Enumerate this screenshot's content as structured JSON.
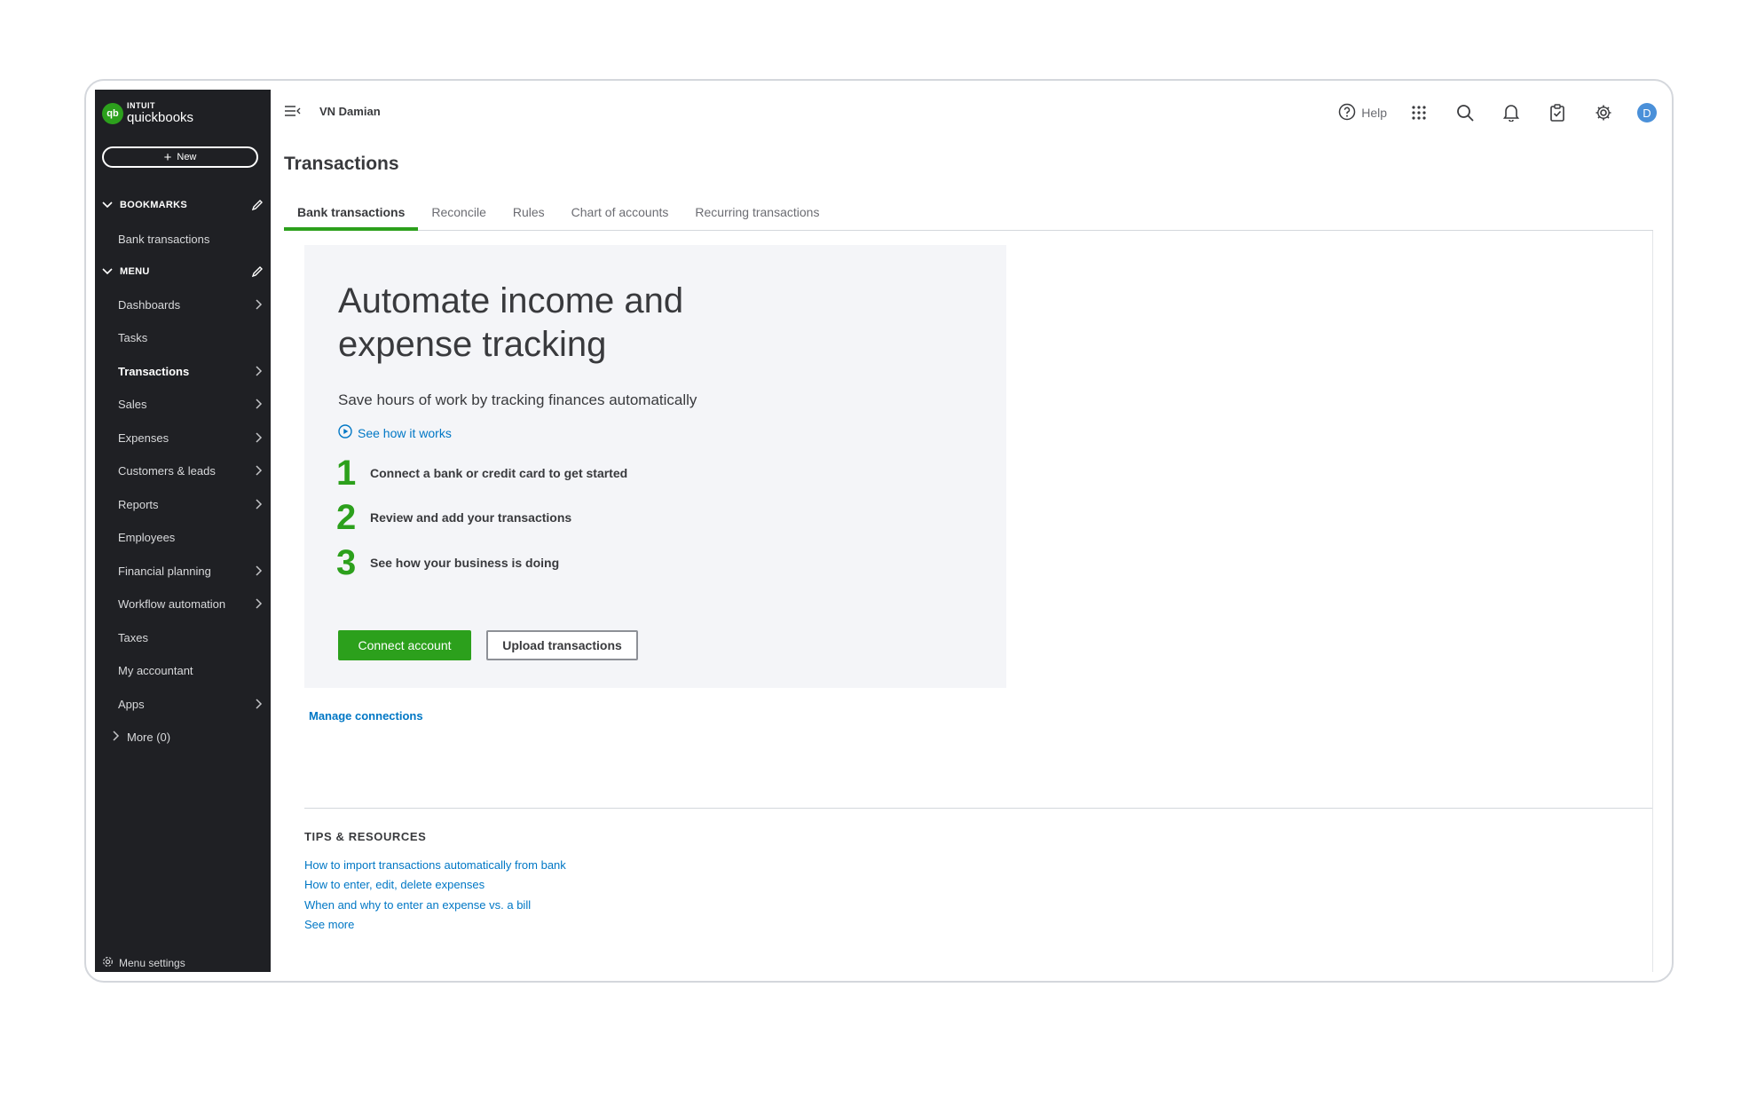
{
  "brand": {
    "intuit": "INTUIT",
    "product": "quickbooks",
    "badge": "qb"
  },
  "sidebar": {
    "new_label": "New",
    "bookmarks_title": "BOOKMARKS",
    "bookmarks": [
      {
        "label": "Bank transactions"
      }
    ],
    "menu_title": "MENU",
    "items": [
      {
        "label": "Dashboards",
        "arrow": true
      },
      {
        "label": "Tasks",
        "arrow": false
      },
      {
        "label": "Transactions",
        "arrow": true,
        "active": true
      },
      {
        "label": "Sales",
        "arrow": true
      },
      {
        "label": "Expenses",
        "arrow": true
      },
      {
        "label": "Customers & leads",
        "arrow": true
      },
      {
        "label": "Reports",
        "arrow": true
      },
      {
        "label": "Employees",
        "arrow": false
      },
      {
        "label": "Financial planning",
        "arrow": true
      },
      {
        "label": "Workflow automation",
        "arrow": true
      },
      {
        "label": "Taxes",
        "arrow": false
      },
      {
        "label": "My accountant",
        "arrow": false
      },
      {
        "label": "Apps",
        "arrow": true
      }
    ],
    "more_label": "More (0)",
    "settings_label": "Menu settings"
  },
  "topbar": {
    "company": "VN Damian",
    "help_label": "Help",
    "avatar_initial": "D"
  },
  "page": {
    "title": "Transactions",
    "tabs": [
      {
        "label": "Bank transactions",
        "active": true
      },
      {
        "label": "Reconcile"
      },
      {
        "label": "Rules"
      },
      {
        "label": "Chart of accounts"
      },
      {
        "label": "Recurring transactions"
      }
    ]
  },
  "card": {
    "heading": "Automate income and expense tracking",
    "subtitle": "Save hours of work by tracking finances automatically",
    "see_how": "See how it works",
    "steps": [
      {
        "num": "1",
        "text": "Connect a bank or credit card to get started"
      },
      {
        "num": "2",
        "text": "Review and add your transactions"
      },
      {
        "num": "3",
        "text": "See how your business is doing"
      }
    ],
    "primary_button": "Connect account",
    "secondary_button": "Upload transactions"
  },
  "manage_connections": "Manage connections",
  "tips": {
    "title": "TIPS & RESOURCES",
    "links": [
      "How to import transactions automatically from bank",
      "How to enter, edit, delete expenses",
      "When and why to enter an expense vs. a bill",
      "See more"
    ]
  },
  "colors": {
    "accent": "#2ca01c",
    "link": "#0077c5",
    "sidebar_bg": "#1f2024",
    "card_bg": "#f4f5f8"
  }
}
